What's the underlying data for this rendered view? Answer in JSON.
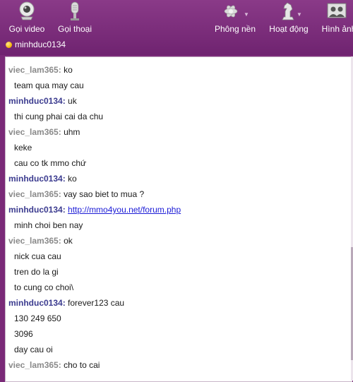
{
  "toolbar": {
    "video_call": "Gọi video",
    "voice_call": "Gọi thoại",
    "background": "Phông nền",
    "activity": "Hoạt động",
    "photos": "Hình ảnh"
  },
  "status": {
    "username": "minhduc0134"
  },
  "messages": [
    {
      "sender": "viec_lam365",
      "text": "ko"
    },
    {
      "text": "team qua may cau"
    },
    {
      "sender": "minhduc0134",
      "text": "uk"
    },
    {
      "text": "thi cung phai cai da chu"
    },
    {
      "sender": "viec_lam365",
      "text": "uhm"
    },
    {
      "text": "keke"
    },
    {
      "text": "cau co tk mmo chứ"
    },
    {
      "sender": "minhduc0134",
      "text": "ko"
    },
    {
      "sender": "viec_lam365",
      "text": "vay sao biet to mua ?"
    },
    {
      "sender": "minhduc0134",
      "link": "http://mmo4you.net/forum.php"
    },
    {
      "text": "minh choi ben nay"
    },
    {
      "sender": "viec_lam365",
      "text": "ok"
    },
    {
      "text": "nick cua cau"
    },
    {
      "text": "tren do la gi"
    },
    {
      "text": "to cung co choi\\"
    },
    {
      "sender": "minhduc0134",
      "text": "forever123 cau"
    },
    {
      "text": "130 249 650"
    },
    {
      "text": "3096"
    },
    {
      "text": "day cau oi"
    },
    {
      "sender": "viec_lam365",
      "text": "cho to cai"
    }
  ],
  "colors": {
    "frame": "#7a2a78",
    "sender_other": "#8a8a8a",
    "sender_self": "#3b3b8f",
    "link": "#1b1bd6"
  }
}
